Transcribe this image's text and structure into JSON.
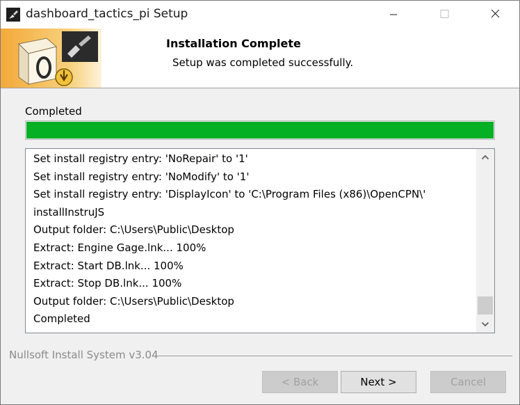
{
  "window": {
    "title": "dashboard_tactics_pi Setup"
  },
  "header": {
    "title": "Installation Complete",
    "subtitle": "Setup was completed successfully."
  },
  "progress": {
    "status": "Completed",
    "percent": 100,
    "color": "#06b025"
  },
  "log": {
    "lines": [
      "Set install registry entry: 'NoRepair' to '1'",
      "Set install registry entry: 'NoModify' to '1'",
      "Set install registry entry: 'DisplayIcon' to 'C:\\Program Files (x86)\\OpenCPN\\'",
      "installInstruJS",
      "Output folder: C:\\Users\\Public\\Desktop",
      "Extract: Engine Gage.lnk... 100%",
      "Extract: Start DB.lnk... 100%",
      "Extract: Stop DB.lnk... 100%",
      "Output folder: C:\\Users\\Public\\Desktop",
      "Completed"
    ],
    "scroll_position": "bottom"
  },
  "branding": "Nullsoft Install System v3.04",
  "buttons": {
    "back": "< Back",
    "next": "Next >",
    "cancel": "Cancel"
  },
  "icons": {
    "app": "installer-app-icon",
    "header": "installer-box-icon"
  }
}
